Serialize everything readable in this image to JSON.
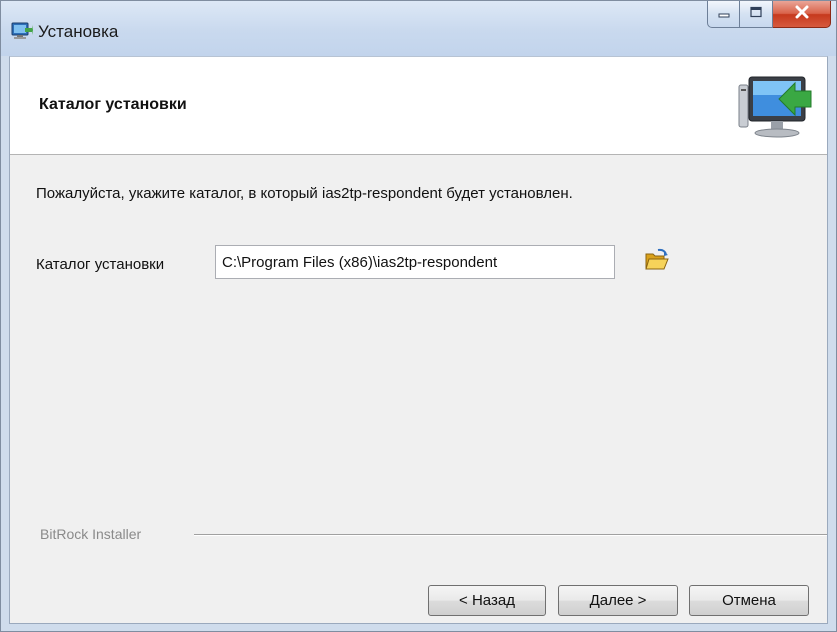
{
  "window": {
    "title": "Установка",
    "icon": "installer-computer-icon",
    "controls": [
      "minimize-icon",
      "maximize-icon",
      "close-icon"
    ]
  },
  "header": {
    "title": "Каталог установки",
    "image": "computer-install-arrow-icon"
  },
  "body": {
    "description": "Пожалуйста, укажите каталог, в который ias2tp-respondent будет установлен.",
    "dir_label": "Каталог установки",
    "dir_value": "C:\\Program Files (x86)\\ias2tp-respondent",
    "browse_icon": "folder-open-icon"
  },
  "footer": {
    "brand": "BitRock Installer",
    "back_label": "< Назад",
    "next_label": "Далее >",
    "cancel_label": "Отмена"
  }
}
